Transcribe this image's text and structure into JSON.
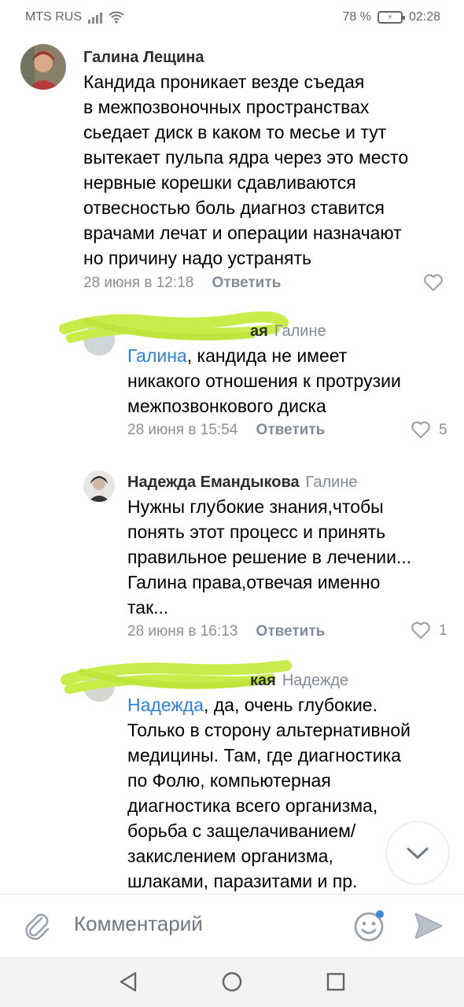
{
  "status_bar": {
    "carrier": "MTS RUS",
    "battery_percent": "78 %",
    "time": "02:28"
  },
  "comments": [
    {
      "author": "Галина Лещина",
      "reply_to": "",
      "text": "Кандида проникает везде  съедая\nв межпозвоночных пространствах\nсьедает диск  в каком то месье и тут\nвытекает пульпа ядра через это место\nнервные корешки сдавливаются\nотвесностью  боль  диагноз ставится\nврачами лечат  и операции назначают\nно причину надо устранять",
      "date": "28 июня в 12:18",
      "reply_label": "Ответить",
      "likes": ""
    },
    {
      "author": "ая",
      "reply_to": "Галине",
      "mention": "Галина",
      "text": ", кандида не имеет\nникакого отношения к протрузии\nмежпозвонкового диска",
      "date": "28 июня в 15:54",
      "reply_label": "Ответить",
      "likes": "5"
    },
    {
      "author": "Надежда Емандыкова",
      "reply_to": "Галине",
      "text": "Нужны глубокие знания,чтобы\nпонять этот процесс и принять\nправильное решение в лечении...\nГалина права,отвечая именно\nтак...",
      "date": "28 июня в 16:13",
      "reply_label": "Ответить",
      "likes": "1"
    },
    {
      "author": "кая",
      "reply_to": "Надежде",
      "mention": "Надежда",
      "text": ", да, очень глубокие.\nТолько в сторону альтернативной\nмедицины. Там, где диагностика\nпо Фолю, компьютерная\nдиагностика всего организма,\nборьба с защелачиванием/\nзакислением  организма,\nшлаками, паразитами и пр."
    }
  ],
  "comment_bar": {
    "placeholder": "Комментарий"
  },
  "colors": {
    "link": "#2d81e0",
    "muted": "#818c99",
    "scribble": "#c8ec4a"
  },
  "icons": [
    "paperclip-icon",
    "emoji-icon",
    "send-icon",
    "chevron-down-icon",
    "heart-icon",
    "back-icon",
    "home-icon",
    "recents-icon"
  ]
}
